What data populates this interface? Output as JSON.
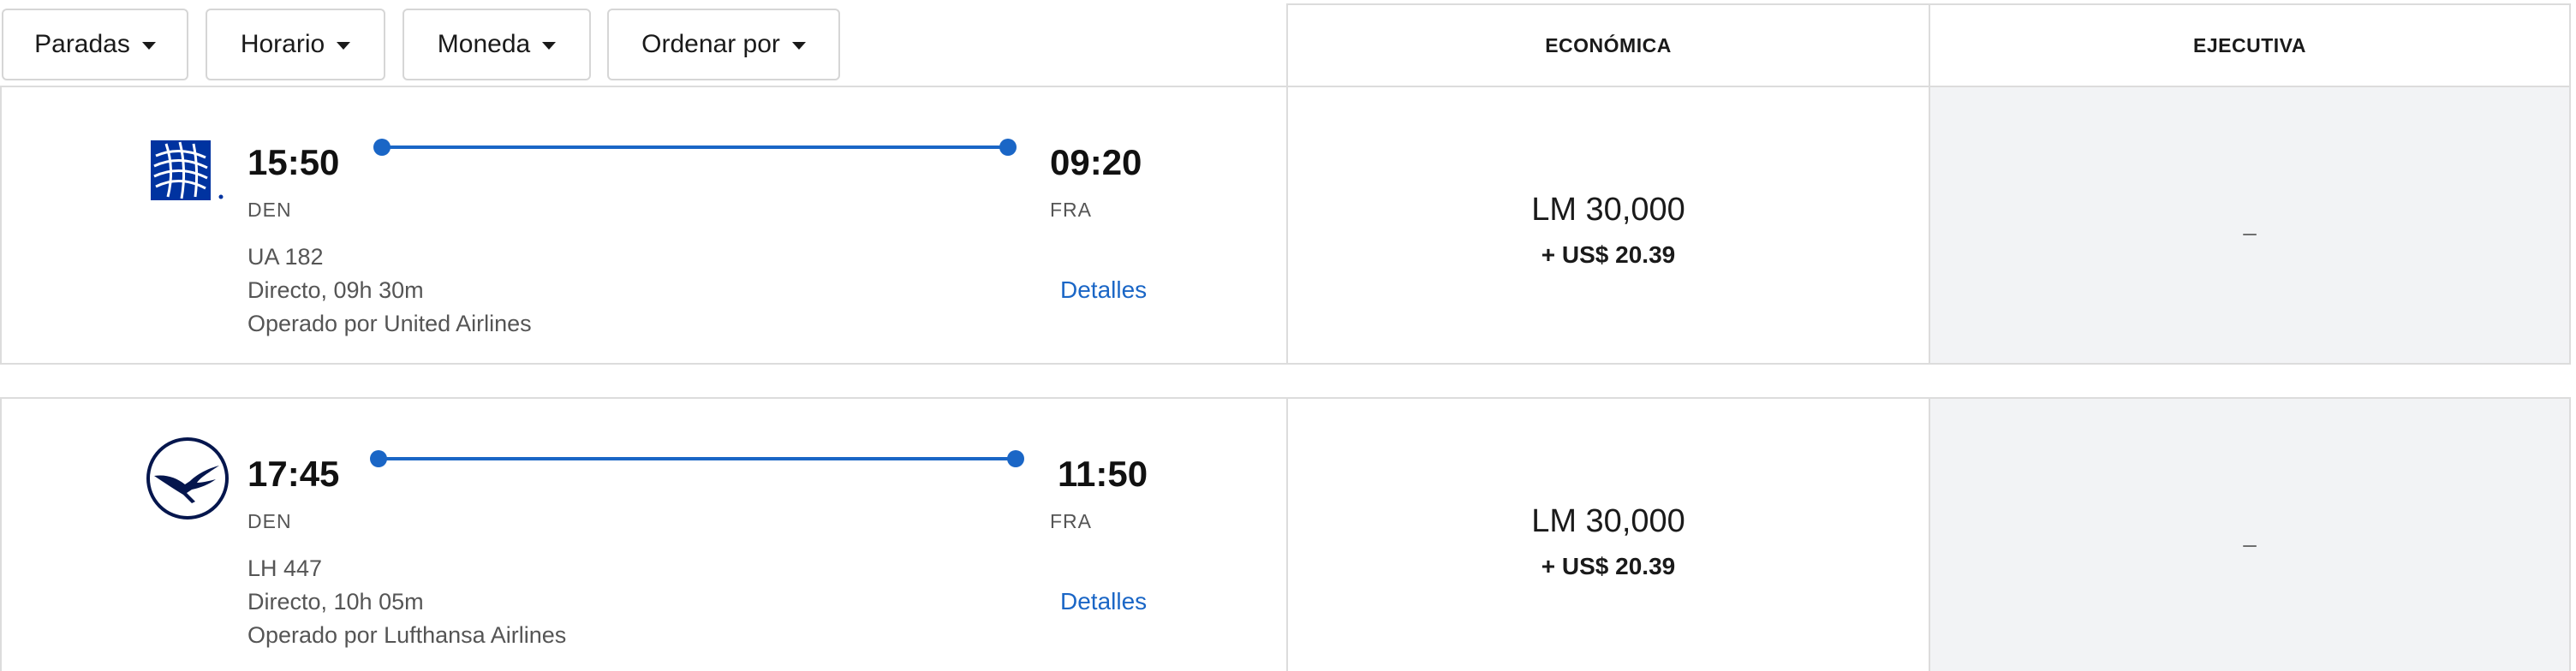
{
  "filters": {
    "stops": "Paradas",
    "schedule": "Horario",
    "currency": "Moneda",
    "sort": "Ordenar por"
  },
  "cabins": {
    "economy": "ECONÓMICA",
    "business": "EJECUTIVA"
  },
  "flights": [
    {
      "airline_icon": "united-globe-icon",
      "depart_time": "15:50",
      "depart_code": "DEN",
      "arrive_time": "09:20",
      "arrive_code": "FRA",
      "flight_number": "UA 182",
      "duration": "Directo, 09h 30m",
      "operated_by": "Operado por United Airlines",
      "details_label": "Detalles",
      "economy_miles": "LM 30,000",
      "economy_tax": "+ US$ 20.39",
      "business_price": "–"
    },
    {
      "airline_icon": "lufthansa-crane-icon",
      "depart_time": "17:45",
      "depart_code": "DEN",
      "arrive_time": "11:50",
      "arrive_code": "FRA",
      "flight_number": "LH 447",
      "duration": "Directo, 10h 05m",
      "operated_by": "Operado por Lufthansa Airlines",
      "details_label": "Detalles",
      "economy_miles": "LM 30,000",
      "economy_tax": "+ US$ 20.39",
      "business_price": "–"
    }
  ],
  "colors": {
    "accent": "#1a66c6",
    "border": "#dcdcdc",
    "disabled_bg": "#f2f3f5",
    "united_blue": "#0033a0",
    "lufthansa_navy": "#05164d"
  }
}
